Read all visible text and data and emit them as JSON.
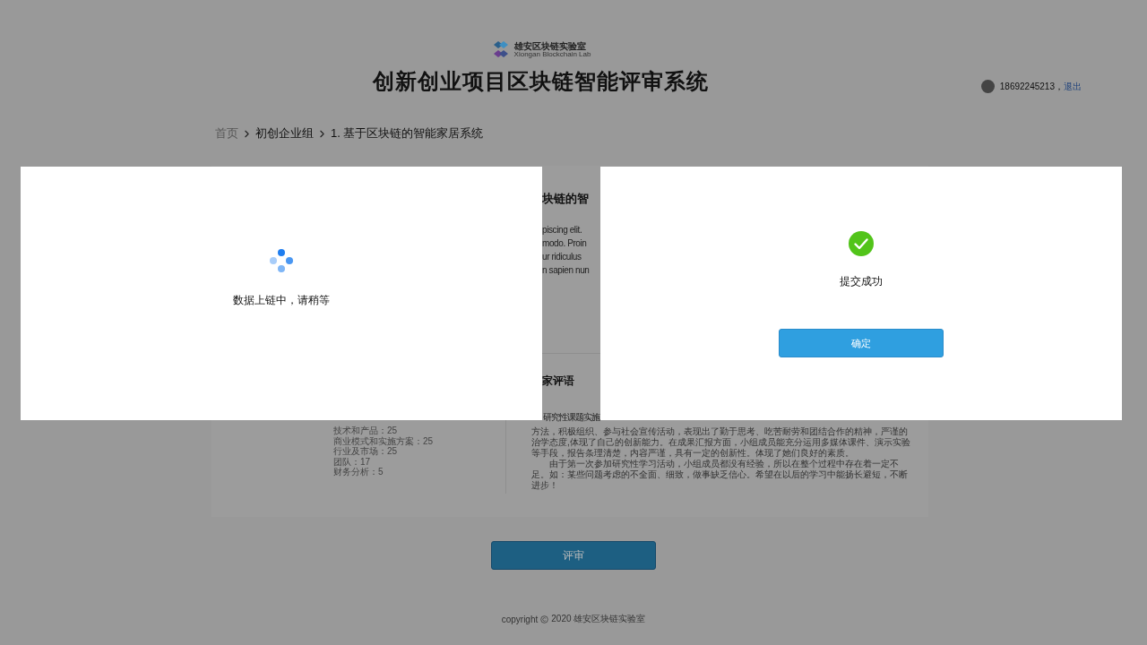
{
  "header": {
    "logo_cn": "雄安区块链实验室",
    "logo_en": "Xiongan Blockchain Lab",
    "title": "创新创业项目区块链智能评审系统"
  },
  "user": {
    "phone": "18692245213，",
    "logout": "退出"
  },
  "breadcrumb": [
    {
      "label": "首页",
      "kind": "link"
    },
    {
      "label": "初创企业组",
      "kind": "current"
    },
    {
      "label": "1. 基于区块链的智能家居系统",
      "kind": "current"
    }
  ],
  "project": {
    "title_fragment": "块链的智",
    "description_fragments": [
      "piscing elit.",
      "modo. Proin",
      "ur ridiculus",
      "n sapien nun"
    ]
  },
  "scores": [
    "技术和产品：25",
    "商业模式和实施方案：25",
    "行业及市场：25",
    "团队：17",
    "财务分析：5"
  ],
  "comments": {
    "heading_fragment": "家评语",
    "first_line_fragment": "研究性课题实施",
    "paragraphs": [
      {
        "text": "方法，积极组织、参与社会宣传活动，表现出了勤于思考、吃苦耐劳和团结合作的精神，严谨的治学态度,体现了自己的创新能力。在成果汇报方面，小组成员能充分运用多媒体课件、演示实验等手段，报告条理清楚，内容严谨，具有一定的创新性。体现了她们良好的素质。",
        "indent": false
      },
      {
        "text": "由于第一次参加研究性学习活动，小组成员都没有经验，所以在整个过程中存在着一定不足。如：某些问题考虑的不全面、细致，做事缺乏信心。希望在以后的学习中能扬长避短，不断进步！",
        "indent": true
      }
    ]
  },
  "review_button": "评审",
  "footer": {
    "copyright": "copyright",
    "owner": "2020 雄安区块链实验室"
  },
  "loading_dialog": {
    "message": "数据上链中，请稍等"
  },
  "success_dialog": {
    "message": "提交成功",
    "confirm": "确定"
  }
}
